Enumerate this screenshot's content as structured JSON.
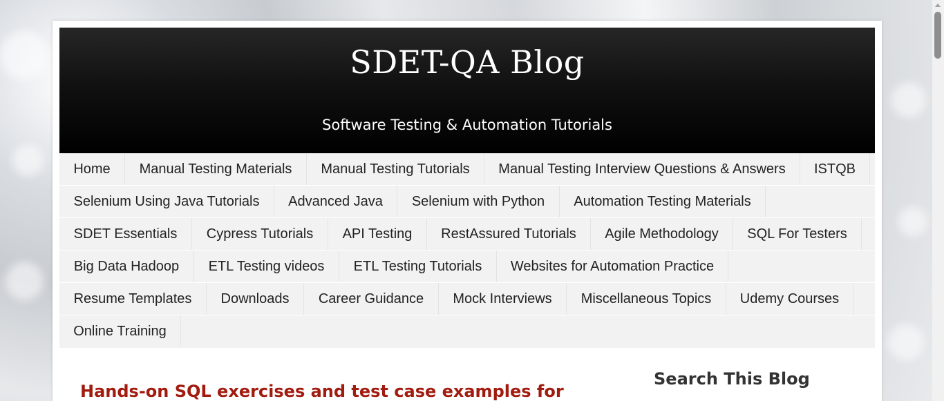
{
  "site": {
    "title": "SDET-QA Blog",
    "tagline": "Software Testing & Automation Tutorials"
  },
  "nav": {
    "items": [
      {
        "label": "Home"
      },
      {
        "label": "Manual Testing Materials"
      },
      {
        "label": "Manual Testing Tutorials"
      },
      {
        "label": "Manual Testing Interview Questions & Answers"
      },
      {
        "label": "ISTQB"
      },
      {
        "label": "Selenium Using Java Tutorials"
      },
      {
        "label": "Advanced Java"
      },
      {
        "label": "Selenium with Python"
      },
      {
        "label": "Automation Testing Materials"
      },
      {
        "label": "SDET Essentials"
      },
      {
        "label": "Cypress Tutorials"
      },
      {
        "label": "API Testing"
      },
      {
        "label": "RestAssured Tutorials"
      },
      {
        "label": "Agile Methodology"
      },
      {
        "label": "SQL For Testers"
      },
      {
        "label": "Big Data Hadoop"
      },
      {
        "label": "ETL Testing videos"
      },
      {
        "label": "ETL Testing Tutorials"
      },
      {
        "label": "Websites for Automation Practice"
      },
      {
        "label": "Resume Templates"
      },
      {
        "label": "Downloads"
      },
      {
        "label": "Career Guidance"
      },
      {
        "label": "Mock Interviews"
      },
      {
        "label": "Miscellaneous Topics"
      },
      {
        "label": "Udemy Courses"
      },
      {
        "label": "Online Training"
      }
    ]
  },
  "post": {
    "title": "Hands-on SQL exercises and test case examples for"
  },
  "sidebar": {
    "search_heading": "Search This Blog"
  },
  "colors": {
    "post_title": "#a11b0f",
    "header_bg": "#000000",
    "nav_bg": "#f2f2f2"
  }
}
